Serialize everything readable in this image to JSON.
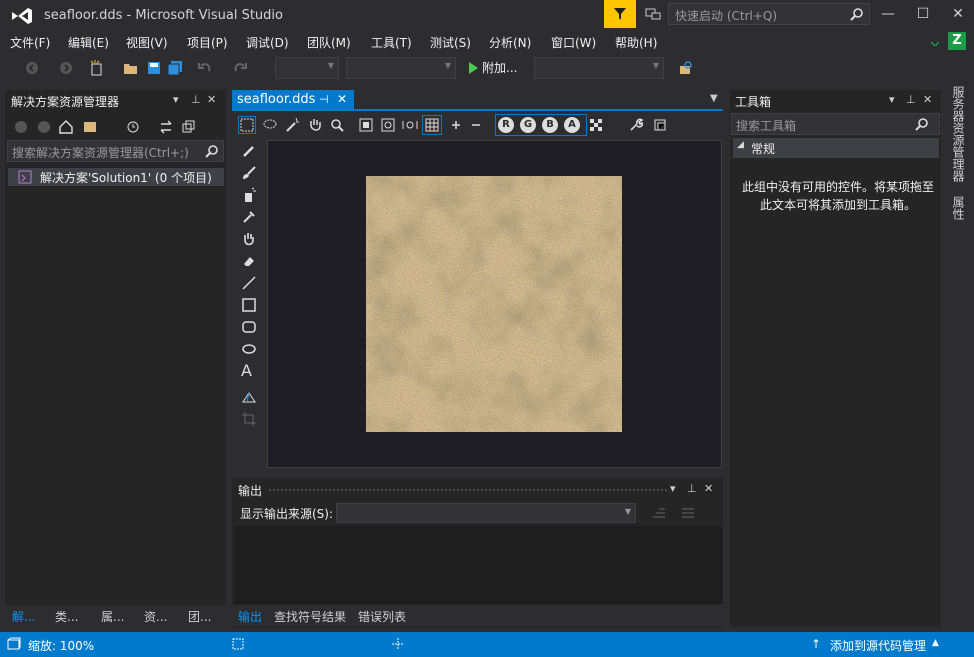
{
  "window": {
    "title": "seafloor.dds - Microsoft Visual Studio",
    "quick_launch_placeholder": "快速启动 (Ctrl+Q)",
    "minimize": "—",
    "maximize": "☐",
    "close": "✕",
    "account_badge": "Z"
  },
  "menu": [
    "文件(F)",
    "编辑(E)",
    "视图(V)",
    "项目(P)",
    "调试(D)",
    "团队(M)",
    "工具(T)",
    "测试(S)",
    "分析(N)",
    "窗口(W)",
    "帮助(H)"
  ],
  "toolbar": {
    "attach_label": "附加..."
  },
  "solution_explorer": {
    "title": "解决方案资源管理器",
    "search_placeholder": "搜索解决方案资源管理器(Ctrl+;)",
    "root_item": "解决方案'Solution1' (0 个项目)",
    "bottom_tabs": [
      "解...",
      "类...",
      "属...",
      "资...",
      "团..."
    ]
  },
  "document": {
    "tab_title": "seafloor.dds",
    "channel_buttons": [
      "R",
      "G",
      "B",
      "A"
    ]
  },
  "output": {
    "title": "输出",
    "source_label": "显示输出来源(S):",
    "bottom_tabs": [
      "输出",
      "查找符号结果",
      "错误列表"
    ]
  },
  "toolbox": {
    "title": "工具箱",
    "search_placeholder": "搜索工具箱",
    "group_name": "常规",
    "empty_message": "此组中没有可用的控件。将某项拖至此文本可将其添加到工具箱。"
  },
  "side_strip": {
    "tabs": [
      "服务器资源管理器",
      "属性"
    ]
  },
  "status": {
    "zoom": "缩放: 100%",
    "source_control": "添加到源代码管理"
  },
  "colors": {
    "accent": "#007acc",
    "filter_yellow": "#fdc500",
    "badge_green": "#1e9a48"
  }
}
